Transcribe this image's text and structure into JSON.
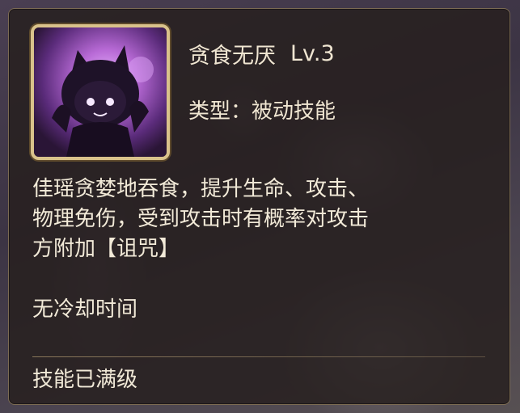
{
  "skill": {
    "name": "贪食无厌",
    "level": "Lv.3",
    "type_text": "类型：被动技能",
    "description_lines": [
      "佳瑶贪婪地吞食，提升生命、攻击、",
      "物理免伤，受到攻击时有概率对攻击",
      "方附加【诅咒】"
    ],
    "cooldown_text": "无冷却时间",
    "max_level_text": "技能已满级",
    "icon": "chibi-girl-skill-icon"
  },
  "colors": {
    "panel_bg": "#261f1e",
    "frame_gold": "#d9c28b",
    "text": "#f2ead8",
    "icon_glow": "#b86ad6"
  }
}
